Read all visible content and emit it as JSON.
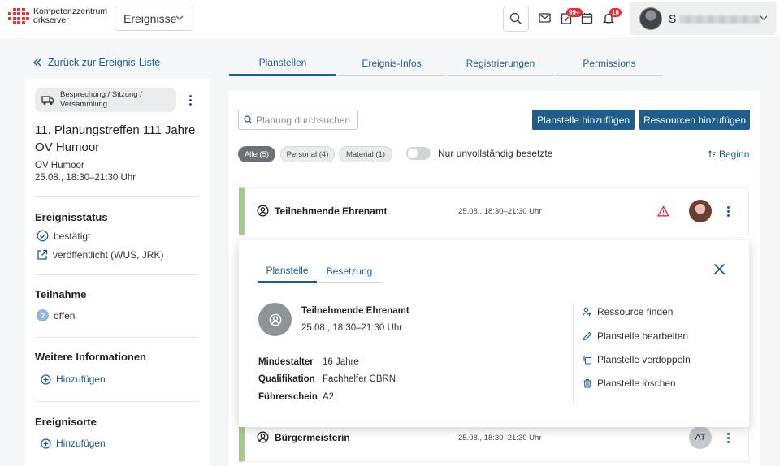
{
  "header": {
    "logo_line1": "Kompetenzzentrum",
    "logo_line2": "drkserver",
    "module_select": "Ereignisse",
    "badge_tasks": "99+",
    "badge_notifications": "16",
    "user_initial": "S",
    "accent_color": "#e03a3e"
  },
  "sidebar": {
    "back_label": "Zurück zur Ereignis-Liste",
    "type_chip_line1": "Besprechung / Sitzung /",
    "type_chip_line2": "Versammlung",
    "event_title": "11. Planungstreffen 111 Jahre OV Humoor",
    "event_org": "OV Humoor",
    "event_time": "25.08., 18:30–21:30 Uhr",
    "status_heading": "Ereignisstatus",
    "status_confirmed": "bestätigt",
    "status_published": "veröffentlicht (WUS, JRK)",
    "participation_heading": "Teilnahme",
    "participation_value": "offen",
    "more_info_heading": "Weitere Informationen",
    "more_info_add": "Hinzufügen",
    "locations_heading": "Ereignisorte",
    "locations_add": "Hinzufügen"
  },
  "tabs": [
    "Planstellen",
    "Ereignis-Infos",
    "Registrierungen",
    "Permissions"
  ],
  "main": {
    "search_placeholder": "Planung durchsuchen",
    "add_position_button": "Planstelle hinzufügen",
    "add_resources_button": "Ressourcen hinzufügen",
    "filters": [
      {
        "label": "Alle (5)",
        "active": true
      },
      {
        "label": "Personal (4)",
        "active": false
      },
      {
        "label": "Material (1)",
        "active": false
      }
    ],
    "toggle_label": "Nur unvollständig besetzte",
    "sort_label": "Beginn",
    "rows": [
      {
        "title": "Teilnehmende Ehrenamt",
        "date": "25.08., 18:30–21:30 Uhr",
        "warning": true
      },
      {
        "title": "Bürgermeisterin",
        "date": "25.08., 18:30–21:30 Uhr",
        "initials": "AT"
      }
    ]
  },
  "popup": {
    "tabs": [
      "Planstelle",
      "Besetzung"
    ],
    "title": "Teilnehmende Ehrenamt",
    "date": "25.08., 18:30–21:30 Uhr",
    "attributes": [
      {
        "key": "Mindestalter",
        "value": "16 Jahre"
      },
      {
        "key": "Qualifikation",
        "value": "Fachhelfer CBRN"
      },
      {
        "key": "Führerschein",
        "value": "A2"
      }
    ],
    "actions": [
      "Ressource finden",
      "Planstelle bearbeiten",
      "Planstelle verdoppeln",
      "Planstelle löschen"
    ]
  }
}
